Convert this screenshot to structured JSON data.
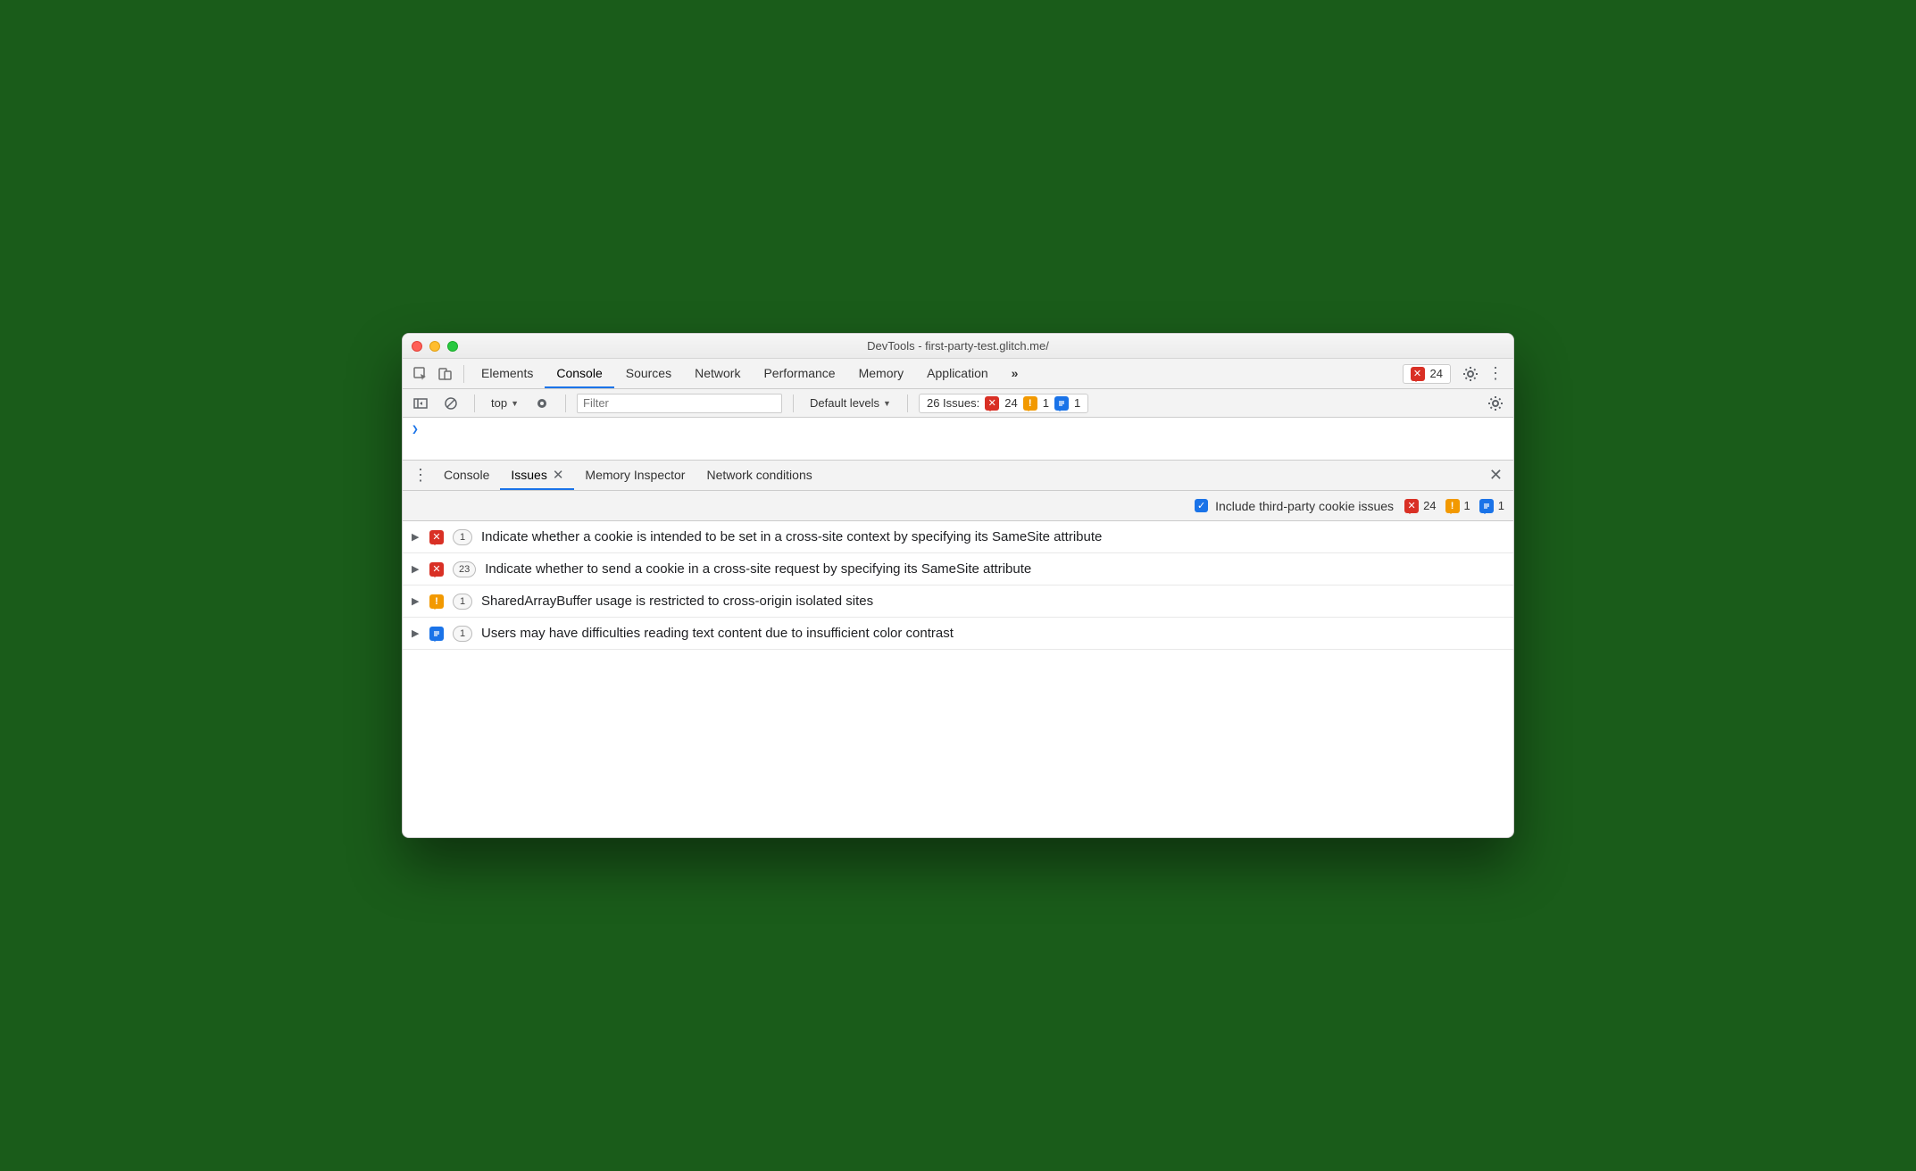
{
  "window": {
    "title": "DevTools - first-party-test.glitch.me/"
  },
  "main_tabs": {
    "items": [
      {
        "label": "Elements"
      },
      {
        "label": "Console"
      },
      {
        "label": "Sources"
      },
      {
        "label": "Network"
      },
      {
        "label": "Performance"
      },
      {
        "label": "Memory"
      },
      {
        "label": "Application"
      }
    ],
    "active": "Console",
    "error_badge_count": "24"
  },
  "console_toolbar": {
    "context": "top",
    "filter_placeholder": "Filter",
    "levels_label": "Default levels",
    "issues_label": "26 Issues:",
    "counts": {
      "errors": "24",
      "warnings": "1",
      "info": "1"
    }
  },
  "console_prompt": "❯",
  "drawer_tabs": {
    "items": [
      {
        "label": "Console"
      },
      {
        "label": "Issues"
      },
      {
        "label": "Memory Inspector"
      },
      {
        "label": "Network conditions"
      }
    ],
    "active": "Issues"
  },
  "issues_panel": {
    "checkbox_label": "Include third-party cookie issues",
    "counts": {
      "errors": "24",
      "warnings": "1",
      "info": "1"
    },
    "rows": [
      {
        "severity": "error",
        "count": "1",
        "text": "Indicate whether a cookie is intended to be set in a cross-site context by specifying its SameSite attribute"
      },
      {
        "severity": "error",
        "count": "23",
        "text": "Indicate whether to send a cookie in a cross-site request by specifying its SameSite attribute"
      },
      {
        "severity": "warning",
        "count": "1",
        "text": "SharedArrayBuffer usage is restricted to cross-origin isolated sites"
      },
      {
        "severity": "info",
        "count": "1",
        "text": "Users may have difficulties reading text content due to insufficient color contrast"
      }
    ]
  }
}
